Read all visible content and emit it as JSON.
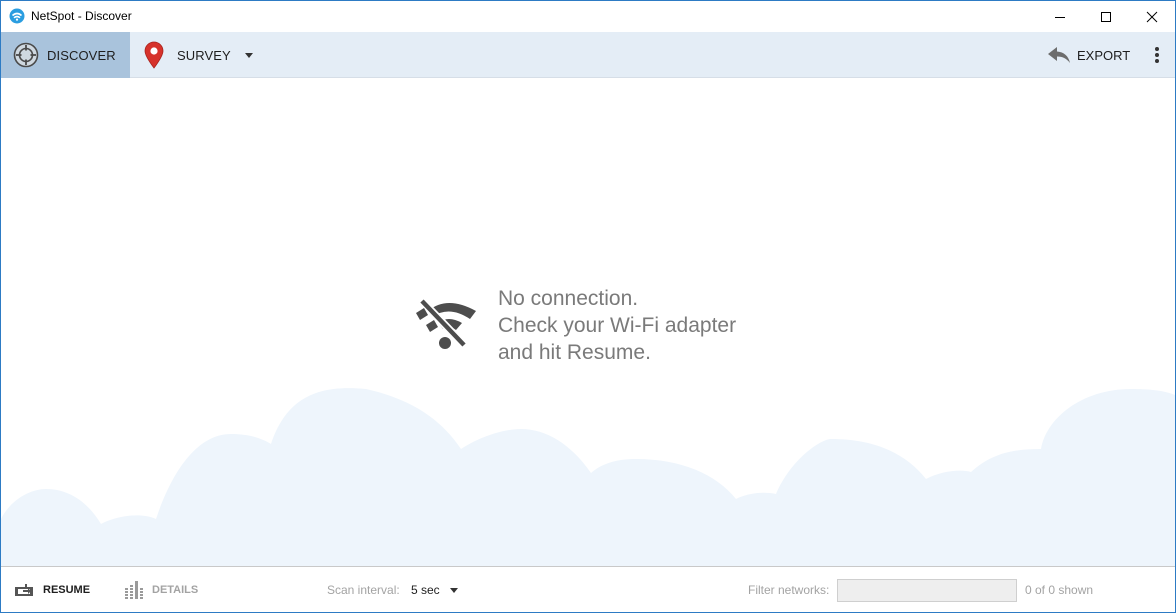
{
  "window": {
    "title": "NetSpot - Discover",
    "controls": {
      "minimize": "minimize-icon",
      "maximize": "maximize-icon",
      "close": "close-icon"
    }
  },
  "toolbar": {
    "tabs": [
      {
        "label": "DISCOVER",
        "icon": "crosshair-icon",
        "active": true
      },
      {
        "label": "SURVEY",
        "icon": "map-pin-icon",
        "active": false
      }
    ],
    "export_label": "EXPORT",
    "export_icon": "reply-arrow-icon",
    "more_icon": "vertical-dots-icon"
  },
  "main": {
    "status_icon": "wifi-off-icon",
    "message_lines": [
      "No connection.",
      "Check your Wi-Fi adapter",
      "and hit Resume."
    ]
  },
  "footer": {
    "resume_label": "RESUME",
    "details_label": "DETAILS",
    "scan_interval_label": "Scan interval:",
    "scan_interval_value": "5 sec",
    "filter_label": "Filter networks:",
    "filter_value": "",
    "filter_placeholder": "",
    "shown_count": "0 of 0 shown"
  },
  "colors": {
    "accent": "#2d7bc4",
    "toolbar_bg": "#e4edf6",
    "active_tab_bg": "#a9c3dc",
    "pin_red": "#d6322b",
    "cloud": "#eef5fc"
  }
}
